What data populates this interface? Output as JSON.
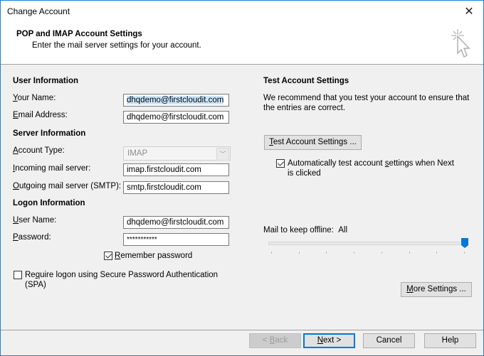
{
  "window": {
    "title": "Change Account",
    "close_icon": "close-icon"
  },
  "header": {
    "title": "POP and IMAP Account Settings",
    "subtitle": "Enter the mail server settings for your account.",
    "icon": "cursor-click-icon"
  },
  "user_info": {
    "heading": "User Information",
    "name_label_u": "Y",
    "name_label_rest": "our Name:",
    "name_value": "dhqdemo@firstcloudit.com",
    "email_label_u": "E",
    "email_label_rest": "mail Address:",
    "email_value": "dhqdemo@firstcloudit.com"
  },
  "server_info": {
    "heading": "Server Information",
    "account_type_label_u": "A",
    "account_type_label_rest": "ccount Type:",
    "account_type_value": "IMAP",
    "incoming_label_u": "I",
    "incoming_label_rest": "ncoming mail server:",
    "incoming_value": "imap.firstcloudit.com",
    "outgoing_label_u": "O",
    "outgoing_label_rest": "utgoing mail server (SMTP):",
    "outgoing_value": "smtp.firstcloudit.com"
  },
  "logon_info": {
    "heading": "Logon Information",
    "user_label_u": "U",
    "user_label_rest": "ser Name:",
    "user_value": "dhqdemo@firstcloudit.com",
    "password_label_u": "P",
    "password_label_rest": "assword:",
    "password_value": "***********",
    "remember_u": "R",
    "remember_rest": "emember password",
    "remember_checked": true,
    "spa_pre": "Re",
    "spa_u": "q",
    "spa_rest": "uire logon using Secure Password Authentication",
    "spa_line2": "(SPA)",
    "spa_checked": false
  },
  "test_settings": {
    "heading": "Test Account Settings",
    "desc_line1": "We recommend that you test your account to ensure that",
    "desc_line2": "the entries are correct.",
    "button_u": "T",
    "button_rest": "est Account Settings ...",
    "auto_pre": "Automatically test account ",
    "auto_u": "s",
    "auto_rest": "ettings when Next",
    "auto_line2": "is clicked",
    "auto_checked": true
  },
  "offline": {
    "label": "Mail to keep offline:",
    "value": "All",
    "slider_position": "8 of 8",
    "tick_count": 8
  },
  "more_settings": {
    "u": "M",
    "rest": "ore Settings ..."
  },
  "footer": {
    "back_pre": "< ",
    "back_u": "B",
    "back_rest": "ack",
    "next_u": "N",
    "next_rest": "ext >",
    "cancel": "Cancel",
    "help": "Help"
  }
}
